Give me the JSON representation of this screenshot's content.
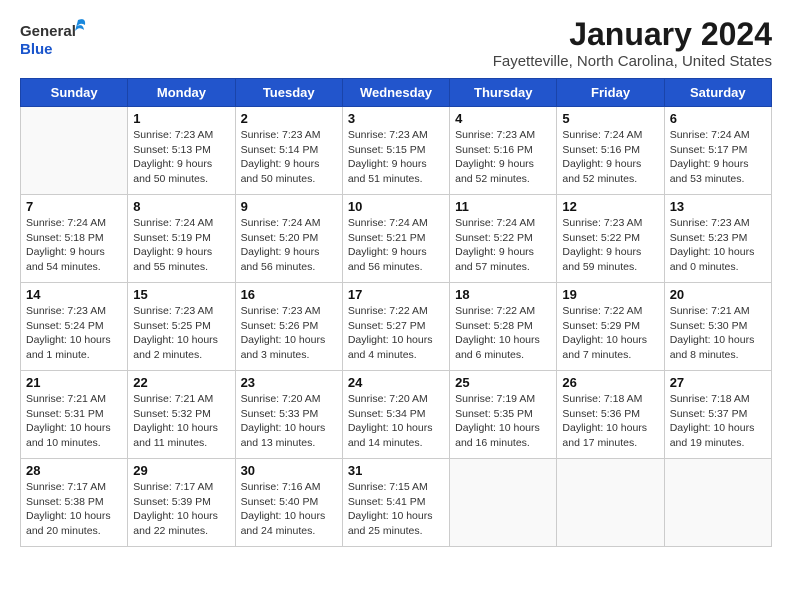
{
  "header": {
    "logo_general": "General",
    "logo_blue": "Blue",
    "title": "January 2024",
    "location": "Fayetteville, North Carolina, United States"
  },
  "days_of_week": [
    "Sunday",
    "Monday",
    "Tuesday",
    "Wednesday",
    "Thursday",
    "Friday",
    "Saturday"
  ],
  "weeks": [
    [
      {
        "day": "",
        "info": ""
      },
      {
        "day": "1",
        "info": "Sunrise: 7:23 AM\nSunset: 5:13 PM\nDaylight: 9 hours\nand 50 minutes."
      },
      {
        "day": "2",
        "info": "Sunrise: 7:23 AM\nSunset: 5:14 PM\nDaylight: 9 hours\nand 50 minutes."
      },
      {
        "day": "3",
        "info": "Sunrise: 7:23 AM\nSunset: 5:15 PM\nDaylight: 9 hours\nand 51 minutes."
      },
      {
        "day": "4",
        "info": "Sunrise: 7:23 AM\nSunset: 5:16 PM\nDaylight: 9 hours\nand 52 minutes."
      },
      {
        "day": "5",
        "info": "Sunrise: 7:24 AM\nSunset: 5:16 PM\nDaylight: 9 hours\nand 52 minutes."
      },
      {
        "day": "6",
        "info": "Sunrise: 7:24 AM\nSunset: 5:17 PM\nDaylight: 9 hours\nand 53 minutes."
      }
    ],
    [
      {
        "day": "7",
        "info": "Sunrise: 7:24 AM\nSunset: 5:18 PM\nDaylight: 9 hours\nand 54 minutes."
      },
      {
        "day": "8",
        "info": "Sunrise: 7:24 AM\nSunset: 5:19 PM\nDaylight: 9 hours\nand 55 minutes."
      },
      {
        "day": "9",
        "info": "Sunrise: 7:24 AM\nSunset: 5:20 PM\nDaylight: 9 hours\nand 56 minutes."
      },
      {
        "day": "10",
        "info": "Sunrise: 7:24 AM\nSunset: 5:21 PM\nDaylight: 9 hours\nand 56 minutes."
      },
      {
        "day": "11",
        "info": "Sunrise: 7:24 AM\nSunset: 5:22 PM\nDaylight: 9 hours\nand 57 minutes."
      },
      {
        "day": "12",
        "info": "Sunrise: 7:23 AM\nSunset: 5:22 PM\nDaylight: 9 hours\nand 59 minutes."
      },
      {
        "day": "13",
        "info": "Sunrise: 7:23 AM\nSunset: 5:23 PM\nDaylight: 10 hours\nand 0 minutes."
      }
    ],
    [
      {
        "day": "14",
        "info": "Sunrise: 7:23 AM\nSunset: 5:24 PM\nDaylight: 10 hours\nand 1 minute."
      },
      {
        "day": "15",
        "info": "Sunrise: 7:23 AM\nSunset: 5:25 PM\nDaylight: 10 hours\nand 2 minutes."
      },
      {
        "day": "16",
        "info": "Sunrise: 7:23 AM\nSunset: 5:26 PM\nDaylight: 10 hours\nand 3 minutes."
      },
      {
        "day": "17",
        "info": "Sunrise: 7:22 AM\nSunset: 5:27 PM\nDaylight: 10 hours\nand 4 minutes."
      },
      {
        "day": "18",
        "info": "Sunrise: 7:22 AM\nSunset: 5:28 PM\nDaylight: 10 hours\nand 6 minutes."
      },
      {
        "day": "19",
        "info": "Sunrise: 7:22 AM\nSunset: 5:29 PM\nDaylight: 10 hours\nand 7 minutes."
      },
      {
        "day": "20",
        "info": "Sunrise: 7:21 AM\nSunset: 5:30 PM\nDaylight: 10 hours\nand 8 minutes."
      }
    ],
    [
      {
        "day": "21",
        "info": "Sunrise: 7:21 AM\nSunset: 5:31 PM\nDaylight: 10 hours\nand 10 minutes."
      },
      {
        "day": "22",
        "info": "Sunrise: 7:21 AM\nSunset: 5:32 PM\nDaylight: 10 hours\nand 11 minutes."
      },
      {
        "day": "23",
        "info": "Sunrise: 7:20 AM\nSunset: 5:33 PM\nDaylight: 10 hours\nand 13 minutes."
      },
      {
        "day": "24",
        "info": "Sunrise: 7:20 AM\nSunset: 5:34 PM\nDaylight: 10 hours\nand 14 minutes."
      },
      {
        "day": "25",
        "info": "Sunrise: 7:19 AM\nSunset: 5:35 PM\nDaylight: 10 hours\nand 16 minutes."
      },
      {
        "day": "26",
        "info": "Sunrise: 7:18 AM\nSunset: 5:36 PM\nDaylight: 10 hours\nand 17 minutes."
      },
      {
        "day": "27",
        "info": "Sunrise: 7:18 AM\nSunset: 5:37 PM\nDaylight: 10 hours\nand 19 minutes."
      }
    ],
    [
      {
        "day": "28",
        "info": "Sunrise: 7:17 AM\nSunset: 5:38 PM\nDaylight: 10 hours\nand 20 minutes."
      },
      {
        "day": "29",
        "info": "Sunrise: 7:17 AM\nSunset: 5:39 PM\nDaylight: 10 hours\nand 22 minutes."
      },
      {
        "day": "30",
        "info": "Sunrise: 7:16 AM\nSunset: 5:40 PM\nDaylight: 10 hours\nand 24 minutes."
      },
      {
        "day": "31",
        "info": "Sunrise: 7:15 AM\nSunset: 5:41 PM\nDaylight: 10 hours\nand 25 minutes."
      },
      {
        "day": "",
        "info": ""
      },
      {
        "day": "",
        "info": ""
      },
      {
        "day": "",
        "info": ""
      }
    ]
  ]
}
